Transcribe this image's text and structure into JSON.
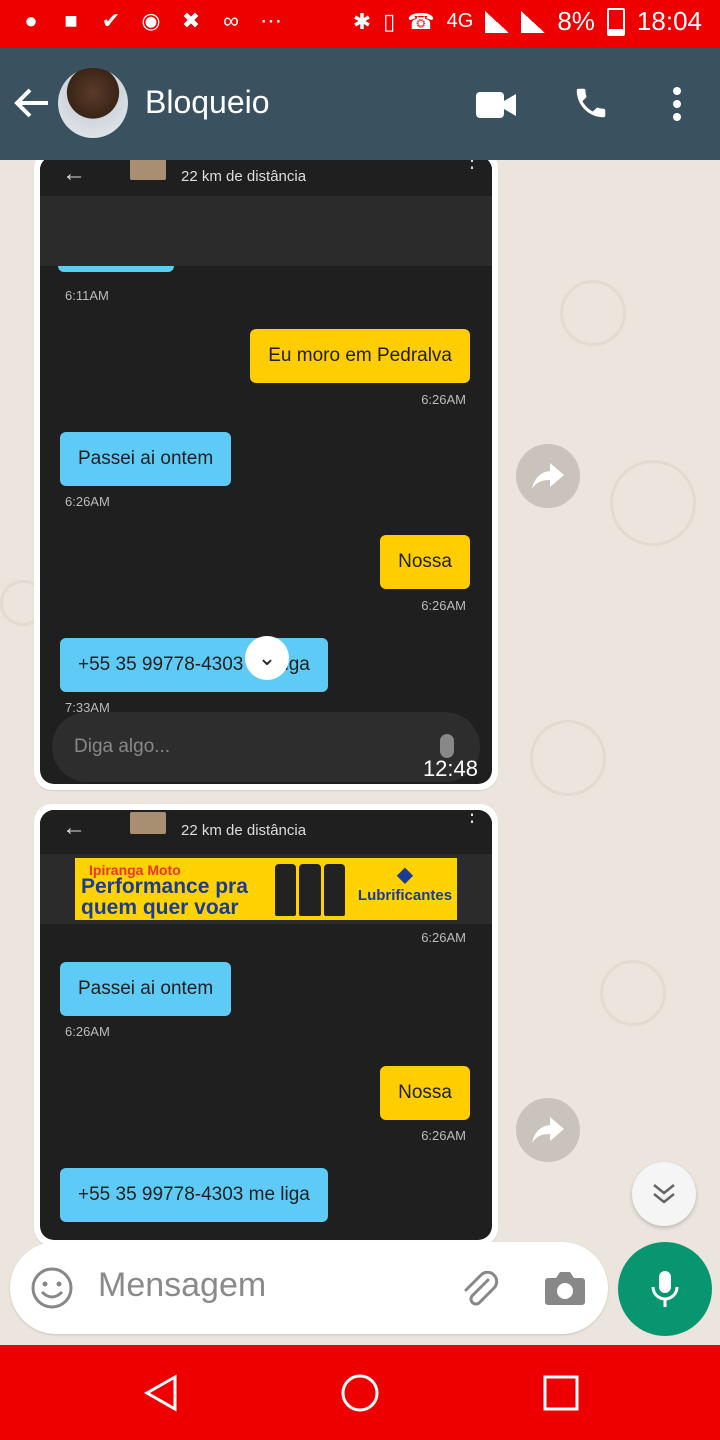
{
  "status_bar": {
    "network": "4G",
    "battery": "8%",
    "time": "18:04",
    "icons": [
      "chat-bubble-icon",
      "trash-icon",
      "check-circle-icon",
      "caixa-tem-icon",
      "x-icon",
      "voicemail-icon",
      "more-dots-icon",
      "bluetooth-icon",
      "vibrate-icon",
      "volte-icon",
      "signal-icon",
      "battery-icon"
    ]
  },
  "header": {
    "contact_name": "Bloqueio",
    "bg_color": "#3a5160"
  },
  "screenshot1": {
    "distance": "22 km de distância",
    "messages": [
      {
        "text": "Eu moro em Pedralva",
        "time": "6:26AM",
        "side": "right"
      },
      {
        "text": "Passei ai ontem",
        "time": "6:26AM",
        "side": "left"
      },
      {
        "text": "Nossa",
        "time": "6:26AM",
        "side": "right"
      },
      {
        "text": "+55 35 99778-4303 me liga",
        "time": "7:33AM",
        "side": "left"
      }
    ],
    "first_time": "6:11AM",
    "input_placeholder": "Diga algo...",
    "timestamp": "12:48"
  },
  "screenshot2": {
    "distance": "22 km de distância",
    "ad": {
      "brand": "Ipiranga Moto",
      "line1": "Performance pra",
      "line2": "quem quer voar",
      "logo": "Lubrificantes"
    },
    "top_time": "6:26AM",
    "messages": [
      {
        "text": "Passei ai ontem",
        "time": "6:26AM",
        "side": "left"
      },
      {
        "text": "Nossa",
        "time": "6:26AM",
        "side": "right"
      },
      {
        "text": "+55 35 99778-4303 me liga",
        "time": "",
        "side": "left"
      }
    ]
  },
  "composer": {
    "placeholder": "Mensagem"
  },
  "colors": {
    "status_bar": "#ee0000",
    "mic_button": "#07966f",
    "blue_bubble": "#5ecbf7",
    "yellow_bubble": "#ffcd00"
  }
}
